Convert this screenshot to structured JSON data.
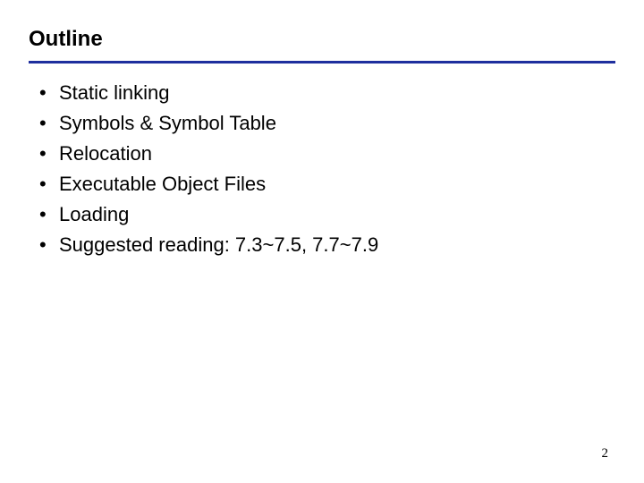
{
  "title": "Outline",
  "bullet_glyph": "•",
  "items": [
    "Static linking",
    "Symbols & Symbol Table",
    "Relocation",
    "Executable Object Files",
    "Loading",
    "Suggested reading: 7.3~7.5, 7.7~7.9"
  ],
  "page_number": "2",
  "accent_color": "#1f2f9e"
}
